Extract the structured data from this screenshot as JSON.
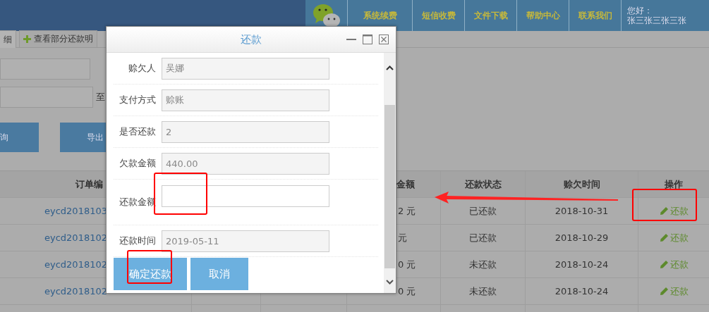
{
  "header": {
    "nav": [
      "系统续费",
      "短信收费",
      "文件下载",
      "帮助中心",
      "联系我们"
    ],
    "greeting": "您好：",
    "user": "张三张三张三张"
  },
  "tabs": [
    {
      "label": "细",
      "selected": true,
      "icon": false
    },
    {
      "label": "查看部分还款明",
      "selected": false,
      "icon": true
    }
  ],
  "filters": {
    "range_separator": "至",
    "buttons": [
      "询",
      "导出"
    ]
  },
  "table": {
    "columns": [
      {
        "label": "订单编"
      },
      {},
      {},
      {
        "label": "金额"
      },
      {
        "label": "还款状态"
      },
      {
        "label": "赊欠时间"
      },
      {
        "label": "操作"
      }
    ],
    "rows": [
      {
        "order": "eycd2018103",
        "amount": "2 元",
        "status": "已还款",
        "date": "2018-10-31",
        "action": "还款"
      },
      {
        "order": "eycd2018102",
        "amount": "元",
        "status": "已还款",
        "date": "2018-10-29",
        "action": "还款"
      },
      {
        "order": "eycd2018102",
        "amount": "0 元",
        "status": "未还款",
        "date": "2018-10-24",
        "action": "还款"
      },
      {
        "order": "eycd2018102",
        "amount": "0 元",
        "status": "未还款",
        "date": "2018-10-24",
        "action": "还款"
      }
    ]
  },
  "dialog": {
    "title": "还款",
    "fields": [
      {
        "label": "赊欠人",
        "value": "吴娜",
        "kind": "readonly"
      },
      {
        "label": "支付方式",
        "value": "赊账",
        "kind": "readonly"
      },
      {
        "label": "是否还款",
        "value": "2",
        "kind": "readonly"
      },
      {
        "label": "欠款金额",
        "value": "440.00",
        "kind": "readonly"
      },
      {
        "label": "还款金额",
        "kind": "input"
      },
      {
        "label": "还款时间",
        "value": "2019-05-11",
        "kind": "readonly"
      }
    ],
    "buttons": [
      "确定还款",
      "取消"
    ]
  }
}
